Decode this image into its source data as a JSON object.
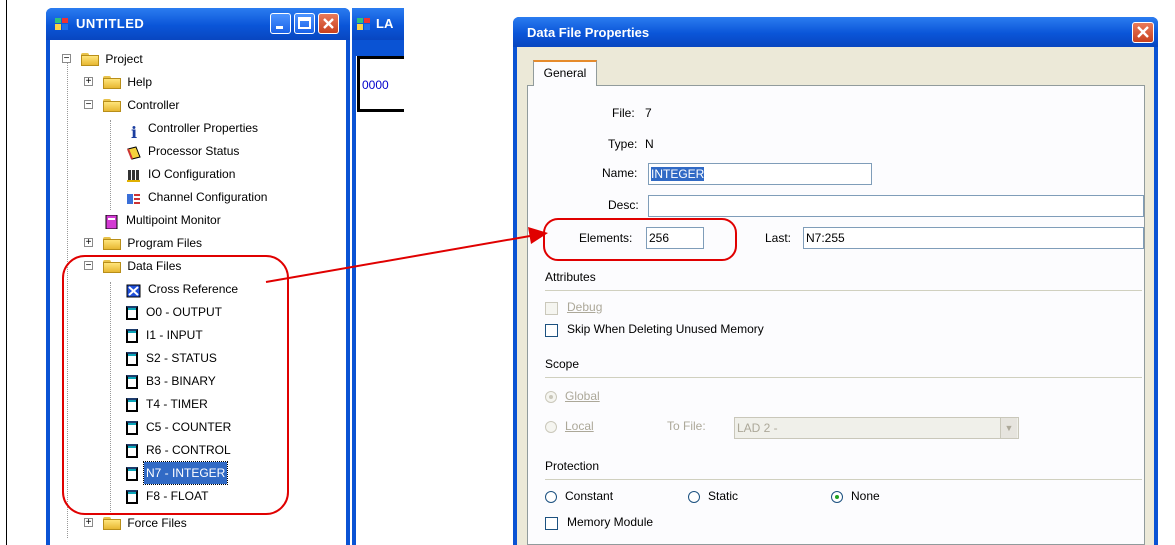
{
  "project_window": {
    "title": "UNTITLED",
    "tree": {
      "project": "Project",
      "help": "Help",
      "controller": "Controller",
      "controller_properties": "Controller Properties",
      "processor_status": "Processor Status",
      "io_configuration": "IO Configuration",
      "channel_configuration": "Channel Configuration",
      "multipoint_monitor": "Multipoint Monitor",
      "program_files": "Program Files",
      "data_files": "Data Files",
      "cross_reference": "Cross Reference",
      "files": [
        "O0 - OUTPUT",
        "I1 - INPUT",
        "S2 - STATUS",
        "B3 - BINARY",
        "T4 - TIMER",
        "C5 - COUNTER",
        "R6 - CONTROL",
        "N7 - INTEGER",
        "F8 - FLOAT"
      ],
      "selected_file": "N7 - INTEGER",
      "force_files": "Force Files"
    }
  },
  "ladder_window": {
    "title_fragment": "LA",
    "rung_number": "0000"
  },
  "dialog": {
    "title": "Data File Properties",
    "tab_general": "General",
    "file_label": "File:",
    "file_value": "7",
    "type_label": "Type:",
    "type_value": "N",
    "name_label": "Name:",
    "name_value": "INTEGER",
    "desc_label": "Desc:",
    "desc_value": "",
    "elements_label": "Elements:",
    "elements_value": "256",
    "last_label": "Last:",
    "last_value": "N7:255",
    "attributes_title": "Attributes",
    "debug_label": "Debug",
    "skip_label": "Skip When Deleting Unused Memory",
    "scope_title": "Scope",
    "global_label": "Global",
    "local_label": "Local",
    "to_file_label": "To File:",
    "to_file_value": "LAD 2 -",
    "protection_title": "Protection",
    "constant_label": "Constant",
    "static_label": "Static",
    "none_label": "None",
    "memory_module_label": "Memory Module"
  },
  "colors": {
    "title_bar": "#0a53d4",
    "selection": "#316ac5",
    "annotation": "#e00000",
    "dialog_face": "#ece9d8"
  }
}
